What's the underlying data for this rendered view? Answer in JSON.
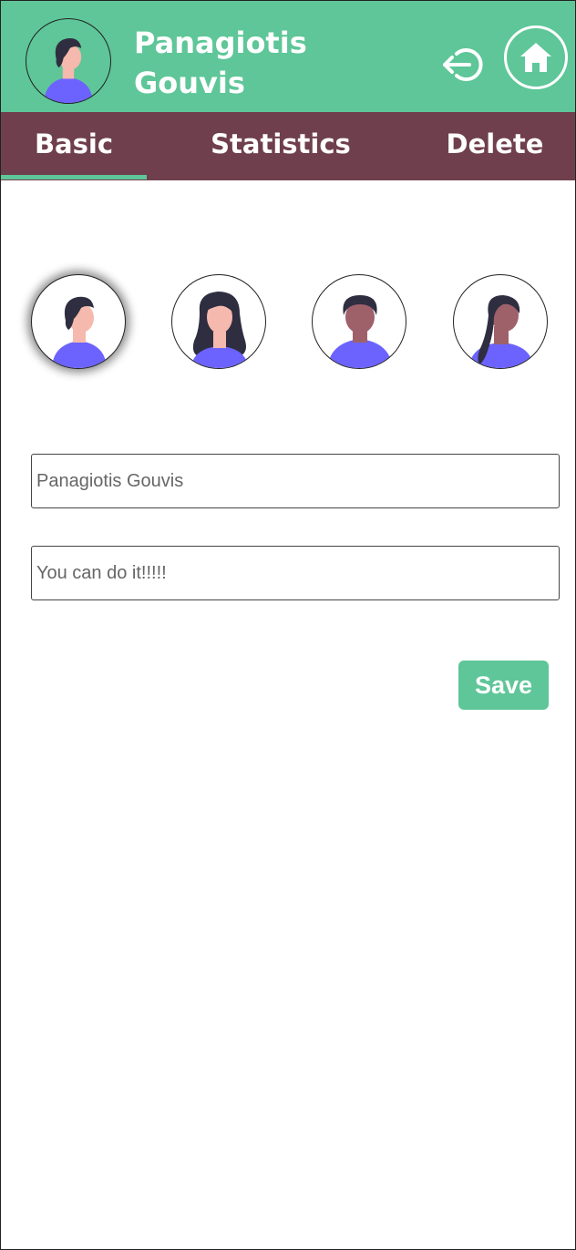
{
  "header": {
    "user_name": "Panagiotis Gouvis",
    "avatar_icon": "male-avatar-icon",
    "logout_icon": "logout-icon",
    "home_icon": "home-icon"
  },
  "tabs": [
    {
      "label": "Basic",
      "active": true
    },
    {
      "label": "Statistics",
      "active": false
    },
    {
      "label": "Delete",
      "active": false
    }
  ],
  "avatars": [
    {
      "icon": "avatar-male-light-icon",
      "selected": true
    },
    {
      "icon": "avatar-female-light-icon",
      "selected": false
    },
    {
      "icon": "avatar-male-dark-icon",
      "selected": false
    },
    {
      "icon": "avatar-female-dark-icon",
      "selected": false
    }
  ],
  "form": {
    "name_value": "Panagiotis Gouvis",
    "motto_value": "You can do it!!!!!",
    "save_label": "Save"
  },
  "colors": {
    "primary": "#5ec698",
    "tab_bar": "#6f3f4d",
    "avatar_shirt": "#6c63ff",
    "hair": "#2f2e41",
    "skin_light": "#f6b9ad",
    "skin_dark": "#9e616a"
  }
}
